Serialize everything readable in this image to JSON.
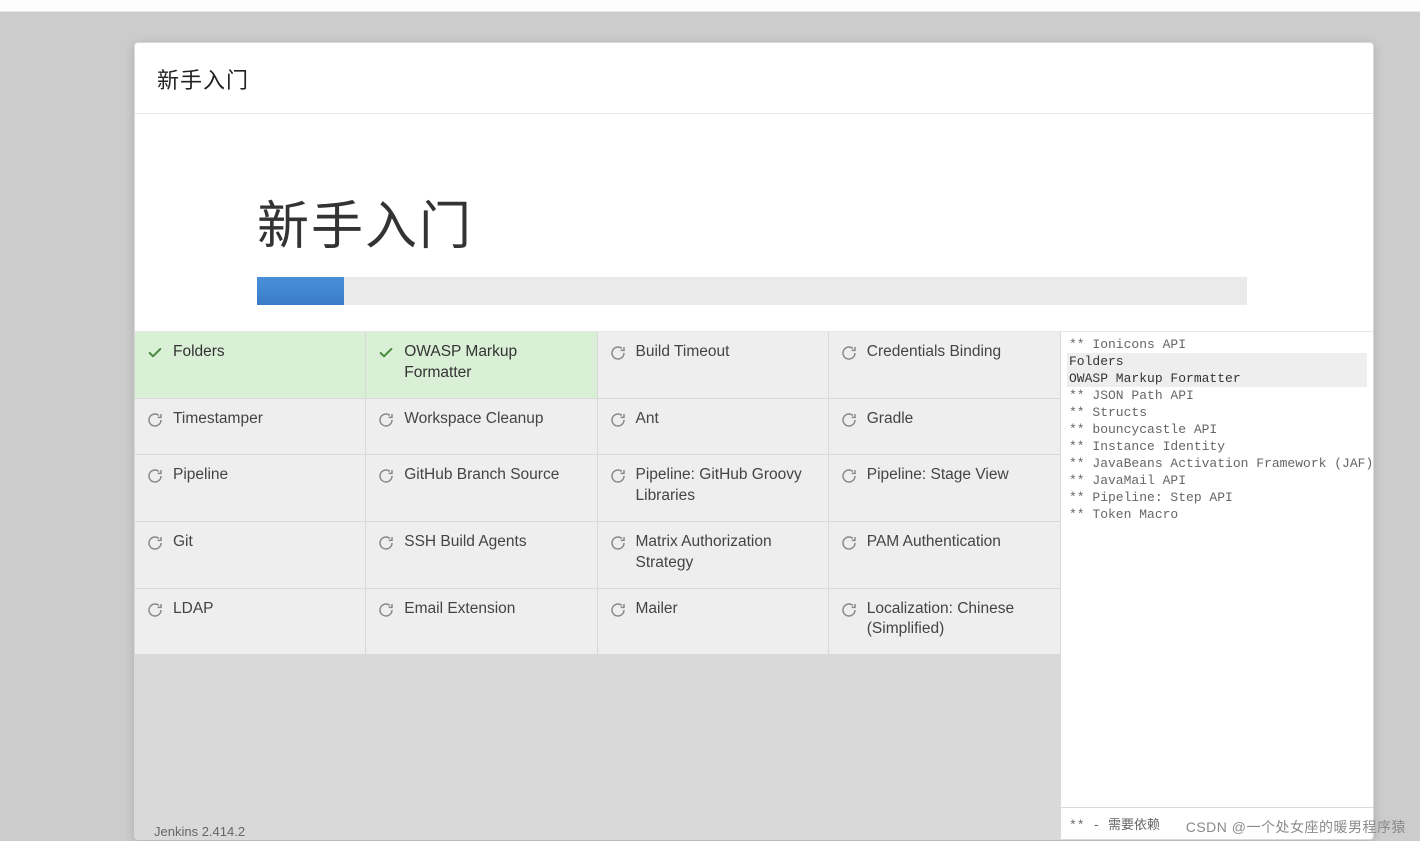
{
  "header": {
    "title": "新手入门"
  },
  "hero": {
    "title": "新手入门",
    "progress_percent": 8.8
  },
  "plugins": [
    {
      "label": "Folders",
      "status": "done"
    },
    {
      "label": "OWASP Markup Formatter",
      "status": "done"
    },
    {
      "label": "Build Timeout",
      "status": "pending"
    },
    {
      "label": "Credentials Binding",
      "status": "pending"
    },
    {
      "label": "Timestamper",
      "status": "pending"
    },
    {
      "label": "Workspace Cleanup",
      "status": "pending"
    },
    {
      "label": "Ant",
      "status": "pending"
    },
    {
      "label": "Gradle",
      "status": "pending"
    },
    {
      "label": "Pipeline",
      "status": "pending"
    },
    {
      "label": "GitHub Branch Source",
      "status": "pending"
    },
    {
      "label": "Pipeline: GitHub Groovy Libraries",
      "status": "pending"
    },
    {
      "label": "Pipeline: Stage View",
      "status": "pending"
    },
    {
      "label": "Git",
      "status": "pending"
    },
    {
      "label": "SSH Build Agents",
      "status": "pending"
    },
    {
      "label": "Matrix Authorization Strategy",
      "status": "pending"
    },
    {
      "label": "PAM Authentication",
      "status": "pending"
    },
    {
      "label": "LDAP",
      "status": "pending"
    },
    {
      "label": "Email Extension",
      "status": "pending"
    },
    {
      "label": "Mailer",
      "status": "pending"
    },
    {
      "label": "Localization: Chinese (Simplified)",
      "status": "pending"
    }
  ],
  "log": {
    "lines": [
      {
        "text": "** Ionicons API",
        "hl": false
      },
      {
        "text": "Folders",
        "hl": true
      },
      {
        "text": "OWASP Markup Formatter",
        "hl": true
      },
      {
        "text": "** JSON Path API",
        "hl": false
      },
      {
        "text": "** Structs",
        "hl": false
      },
      {
        "text": "** bouncycastle API",
        "hl": false
      },
      {
        "text": "** Instance Identity",
        "hl": false
      },
      {
        "text": "** JavaBeans Activation Framework (JAF) API",
        "hl": false
      },
      {
        "text": "** JavaMail API",
        "hl": false
      },
      {
        "text": "** Pipeline: Step API",
        "hl": false
      },
      {
        "text": "** Token Macro",
        "hl": false
      }
    ],
    "footer": "** - 需要依赖"
  },
  "footer": {
    "version": "Jenkins 2.414.2"
  },
  "watermark": "CSDN @一个处女座的暖男程序猿"
}
